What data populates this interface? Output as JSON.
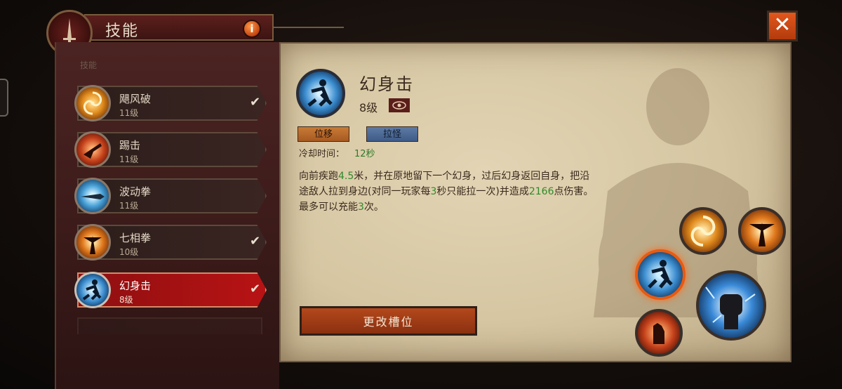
{
  "header": {
    "title": "技能",
    "info_label": "i",
    "close_label": "✕"
  },
  "skill_list": {
    "section_label": "技能",
    "items": [
      {
        "name": "飓风破",
        "level": "11级",
        "checked": "✔",
        "icon": "whirlwind-icon"
      },
      {
        "name": "踢击",
        "level": "11级",
        "checked": "",
        "icon": "kick-icon"
      },
      {
        "name": "波动拳",
        "level": "11级",
        "checked": "",
        "icon": "wave-fist-icon"
      },
      {
        "name": "七相拳",
        "level": "10级",
        "checked": "✔",
        "icon": "seven-sided-strike-icon"
      },
      {
        "name": "幻身击",
        "level": "8级",
        "checked": "✔",
        "icon": "dashing-strike-icon",
        "selected": true
      }
    ]
  },
  "detail": {
    "name": "幻身击",
    "level": "8级",
    "tags": [
      "位移",
      "拉怪"
    ],
    "cooldown_label": "冷却时间：",
    "cooldown_value": "12秒",
    "description": {
      "p1": "向前疾跑",
      "v1": "4.5",
      "p2": "米，并在原地留下一个幻身，过后幻身返回自身，把沿途敌人拉到身边(对同一玩家每",
      "v2": "3",
      "p3": "秒只能拉一次)并造成",
      "v3": "2166",
      "p4": "点伤害。最多可以充能",
      "v4": "3",
      "p5": "次。"
    },
    "change_slot_label": "更改槽位"
  },
  "colors": {
    "accent": "#b81314",
    "button": "#b4481b",
    "highlight_green": "#2f8a2a",
    "close": "#e2571d"
  }
}
